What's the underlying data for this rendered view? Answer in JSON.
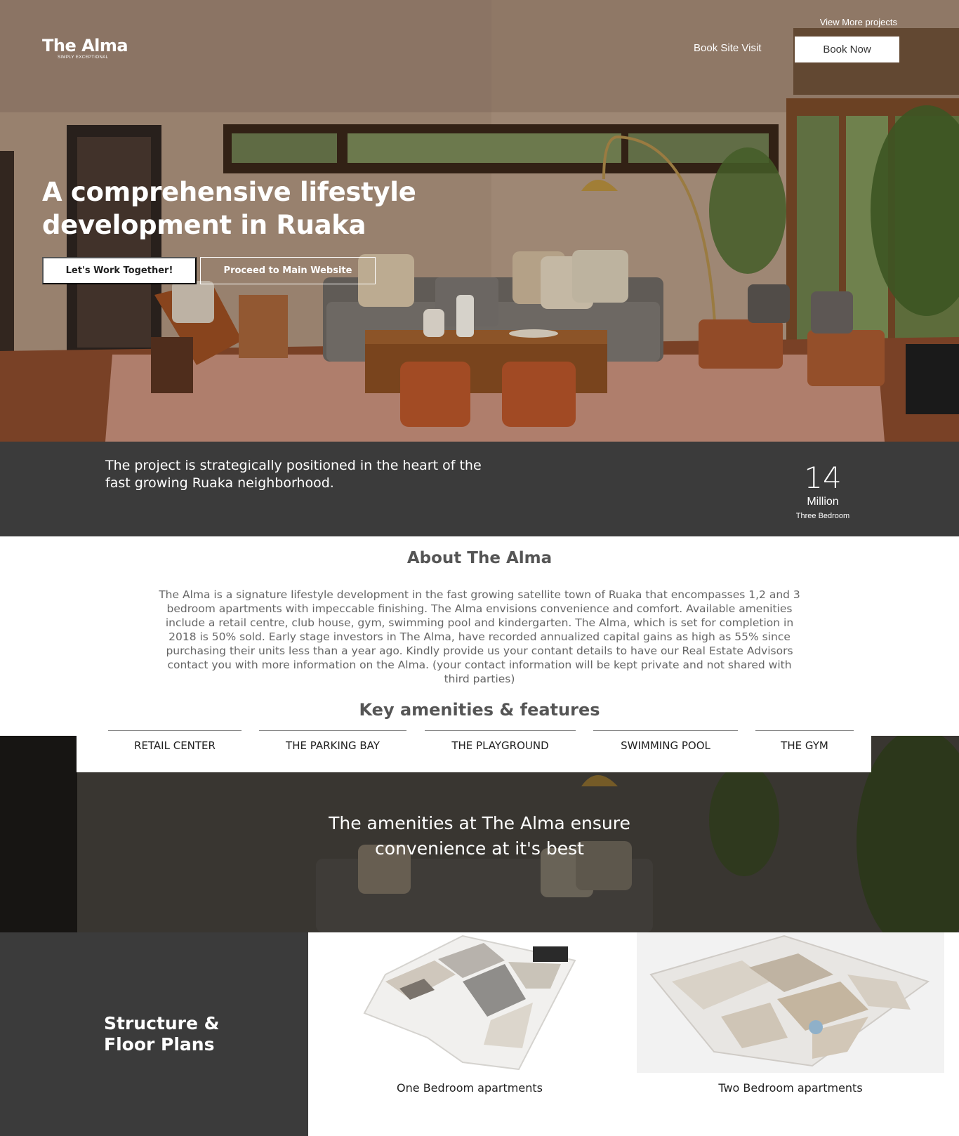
{
  "header": {
    "logo_name": "The Alma",
    "logo_tagline": "SIMPLY EXCEPTIONAL",
    "view_more": "View More projects",
    "book_site_visit": "Book Site Visit",
    "book_now": "Book Now"
  },
  "hero": {
    "title": "A comprehensive lifestyle development in Ruaka",
    "primary_button": "Let's Work Together!",
    "secondary_button": "Proceed to Main Website"
  },
  "strip": {
    "text": "The project is strategically positioned in the heart of the fast growing Ruaka neighborhood.",
    "stat_number": "14",
    "stat_unit": "Million",
    "stat_label": "Three Bedroom"
  },
  "about": {
    "title": "About The Alma",
    "body": "The Alma is a signature lifestyle development in the fast growing satellite town of Ruaka that encompasses 1,2 and 3 bedroom apartments with impeccable finishing. The Alma envisions convenience and comfort. Available amenities include a retail centre, club house, gym, swimming pool and kindergarten. The Alma, which is set for completion in 2018 is 50% sold. Early stage investors in The Alma, have recorded annualized capital gains as high as 55% since purchasing their units less than a year ago. Kindly provide us your contant details to have our Real Estate Advisors contact you with more information on the Alma. (your contact information will be kept private and not shared with third parties)"
  },
  "amenities": {
    "title": "Key amenities & features",
    "tabs": [
      "RETAIL CENTER",
      "THE PARKING BAY",
      "THE PLAYGROUND",
      "SWIMMING POOL",
      "THE GYM"
    ],
    "overlay_text": "The amenities at The Alma ensure convenience at it's best"
  },
  "plans": {
    "title": "Structure & Floor Plans",
    "items": [
      {
        "caption": "One Bedroom apartments"
      },
      {
        "caption": "Two Bedroom apartments"
      }
    ]
  },
  "colors": {
    "dark_band": "#3b3b3b",
    "white": "#ffffff",
    "text_grey": "#666666"
  }
}
